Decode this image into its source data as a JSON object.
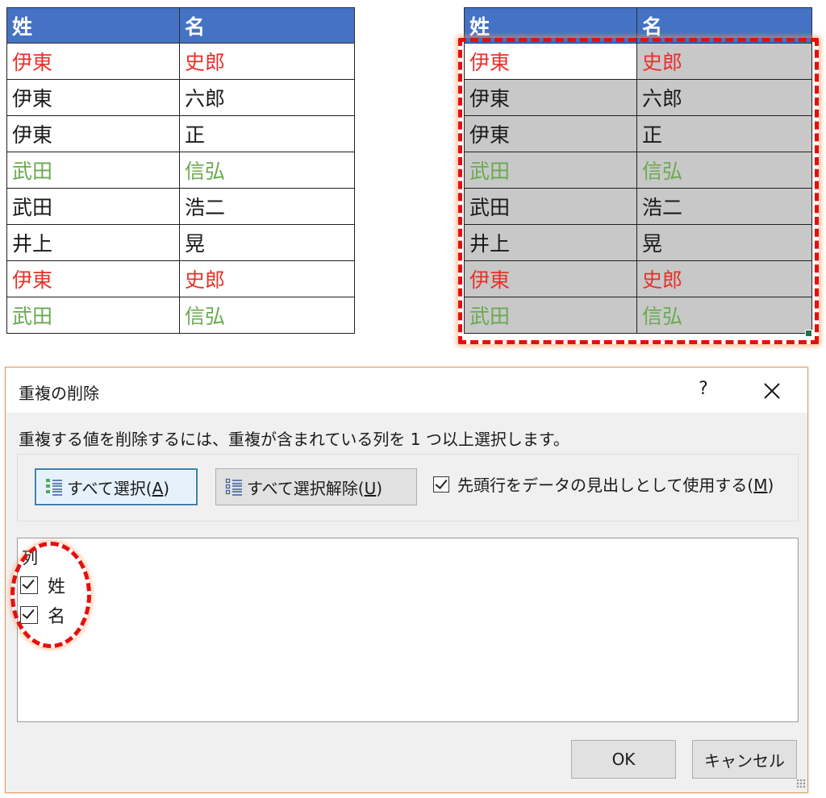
{
  "sheet_left": {
    "headers": [
      "姓",
      "名"
    ],
    "rows": [
      {
        "sei": "伊東",
        "mei": "史郎",
        "color": "#e8302a"
      },
      {
        "sei": "伊東",
        "mei": "六郎",
        "color": "#1a1a1a"
      },
      {
        "sei": "伊東",
        "mei": "正",
        "color": "#1a1a1a"
      },
      {
        "sei": "武田",
        "mei": "信弘",
        "color": "#6aaa50"
      },
      {
        "sei": "武田",
        "mei": "浩二",
        "color": "#1a1a1a"
      },
      {
        "sei": "井上",
        "mei": "晃",
        "color": "#1a1a1a"
      },
      {
        "sei": "伊東",
        "mei": "史郎",
        "color": "#e8302a"
      },
      {
        "sei": "武田",
        "mei": "信弘",
        "color": "#6aaa50"
      }
    ]
  },
  "sheet_right": {
    "headers": [
      "姓",
      "名"
    ],
    "rows": [
      {
        "sei": "伊東",
        "mei": "史郎",
        "color": "#e8302a"
      },
      {
        "sei": "伊東",
        "mei": "六郎",
        "color": "#1a1a1a"
      },
      {
        "sei": "伊東",
        "mei": "正",
        "color": "#1a1a1a"
      },
      {
        "sei": "武田",
        "mei": "信弘",
        "color": "#6aaa50"
      },
      {
        "sei": "武田",
        "mei": "浩二",
        "color": "#1a1a1a"
      },
      {
        "sei": "井上",
        "mei": "晃",
        "color": "#1a1a1a"
      },
      {
        "sei": "伊東",
        "mei": "史郎",
        "color": "#e8302a"
      },
      {
        "sei": "武田",
        "mei": "信弘",
        "color": "#6aaa50"
      }
    ],
    "selection_color": "#c8c8c8",
    "highlight_color": "#e40f0f"
  },
  "dialog": {
    "title": "重複の削除",
    "help": "?",
    "close": "✕",
    "instruction": "重複する値を削除するには、重複が含まれている列を 1 つ以上選択します。",
    "select_all": {
      "text": "すべて選択(",
      "key": "A",
      "end": ")",
      "icon": "select-all-list-icon"
    },
    "deselect_all": {
      "text": "すべて選択解除(",
      "key": "U",
      "end": ")",
      "icon": "deselect-all-list-icon"
    },
    "header_option": {
      "text": "先頭行をデータの見出しとして使用する(",
      "key": "M",
      "end": ")",
      "checked": true
    },
    "columns_label": "列",
    "columns": [
      {
        "label": "姓",
        "checked": true
      },
      {
        "label": "名",
        "checked": true
      }
    ],
    "ok": "OK",
    "cancel": "キャンセル",
    "accent_color": "#3c7fb1"
  }
}
